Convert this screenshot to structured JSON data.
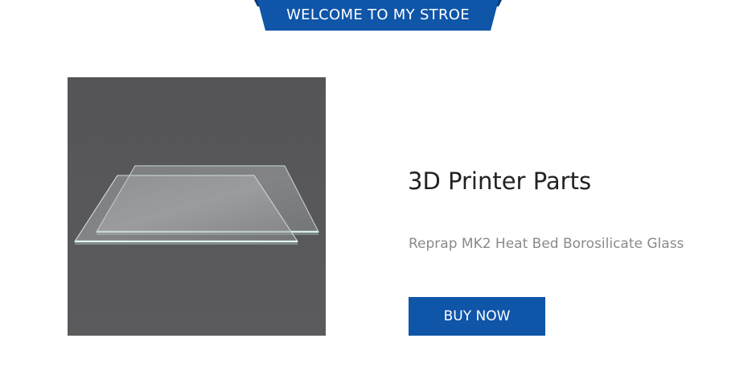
{
  "banner": {
    "text": "WELCOME TO MY STROE",
    "color": "#0f55a8",
    "fold_color": "#0a3c78"
  },
  "product": {
    "image_icon": "glass-plates-photo",
    "image_background": "#575759",
    "title": "3D Printer Parts",
    "subtitle": "Reprap MK2 Heat Bed Borosilicate Glass",
    "buy_label": "BUY NOW",
    "button_color": "#0f55a8"
  }
}
